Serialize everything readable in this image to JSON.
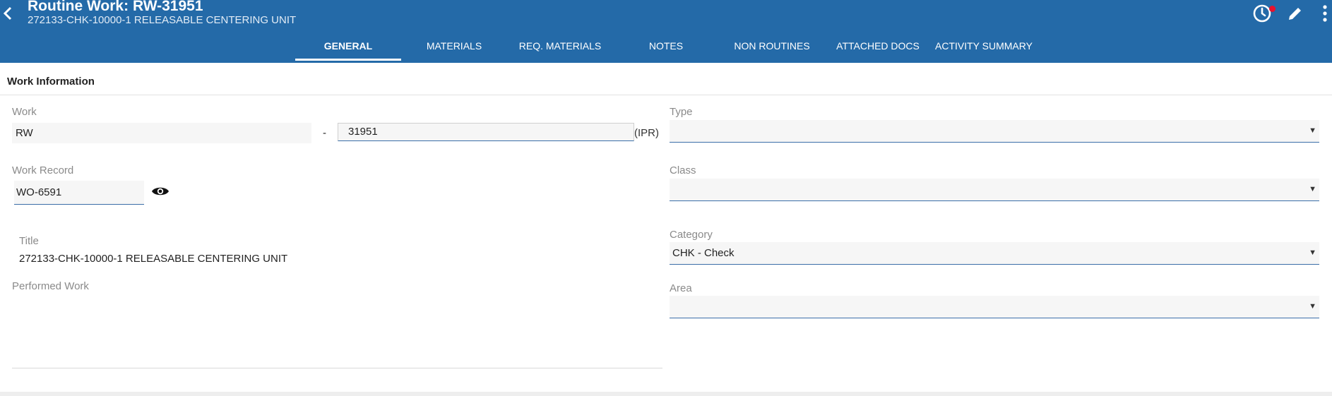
{
  "header": {
    "title": "Routine Work: RW-31951",
    "subtitle": "272133-CHK-10000-1 RELEASABLE CENTERING UNIT",
    "icons": [
      "back-arrow-icon",
      "history-clock-icon",
      "edit-pencil-icon",
      "more-vertical-icon"
    ],
    "accent": "#246aa8",
    "notification_color": "#e8112d"
  },
  "tabs": [
    {
      "label": "GENERAL",
      "active": true
    },
    {
      "label": "MATERIALS",
      "active": false
    },
    {
      "label": "REQ. MATERIALS",
      "active": false
    },
    {
      "label": "NOTES",
      "active": false
    },
    {
      "label": "NON ROUTINES",
      "active": false
    },
    {
      "label": "ATTACHED DOCS",
      "active": false
    },
    {
      "label": "ACTIVITY SUMMARY",
      "active": false
    }
  ],
  "section": {
    "title": "Work Information"
  },
  "form": {
    "work": {
      "label": "Work",
      "prefix": "RW",
      "separator": "-",
      "number": "31951",
      "suffix": "(IPR)"
    },
    "work_record": {
      "label": "Work Record",
      "value": "WO-6591",
      "view_icon": "eye-icon"
    },
    "title": {
      "label": "Title",
      "value": "272133-CHK-10000-1 RELEASABLE CENTERING UNIT"
    },
    "performed_work": {
      "label": "Performed Work",
      "value": ""
    },
    "type": {
      "label": "Type",
      "value": ""
    },
    "class": {
      "label": "Class",
      "value": ""
    },
    "category": {
      "label": "Category",
      "value": "CHK - Check"
    },
    "area": {
      "label": "Area",
      "value": ""
    }
  }
}
